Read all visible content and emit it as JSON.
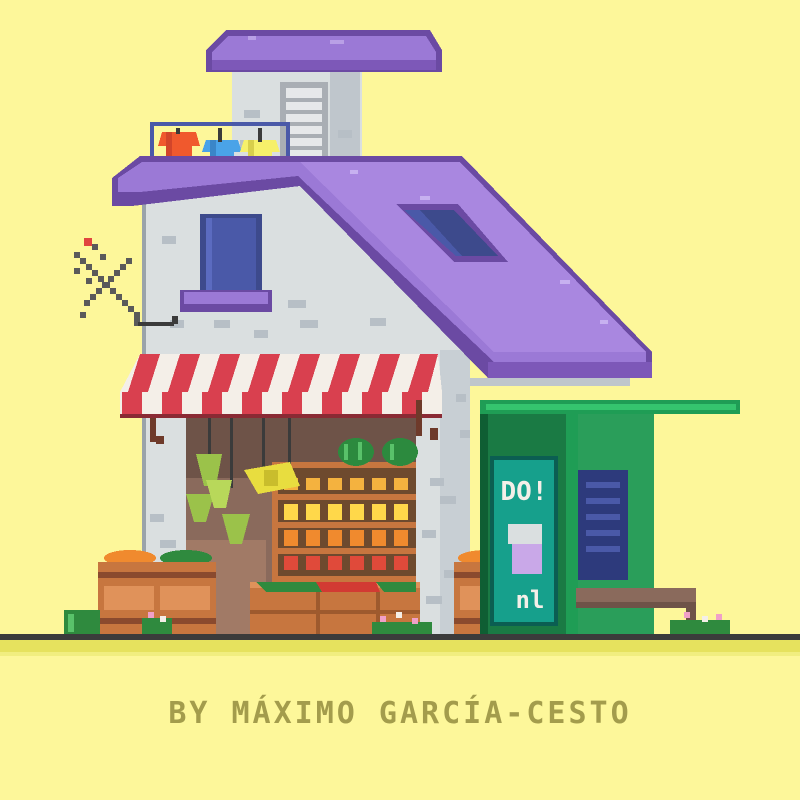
{
  "credit": "BY MÁXIMO GARCÍA-CESTO",
  "poster": {
    "top_text": "DO!",
    "bottom_text": "nl"
  },
  "colors": {
    "background": "#fdf79a",
    "ground_line": "#3b3b3b",
    "grass": "#e6e25e",
    "wall": "#dadfe0",
    "brick": "#b7bfc6",
    "roof_top": "#9b79d6",
    "roof_edge": "#6b4aa3",
    "awning_red": "#d9404f",
    "awning_white": "#f4efe8",
    "window": "#4a59a8",
    "crate": "#c7763f",
    "bus_stop_green": "#1f9d55",
    "credit_text": "#a39c4c"
  },
  "icons": [
    "tv-antenna-icon",
    "clothesline-icon",
    "skylight-icon",
    "poster-icon",
    "timetable-icon"
  ]
}
